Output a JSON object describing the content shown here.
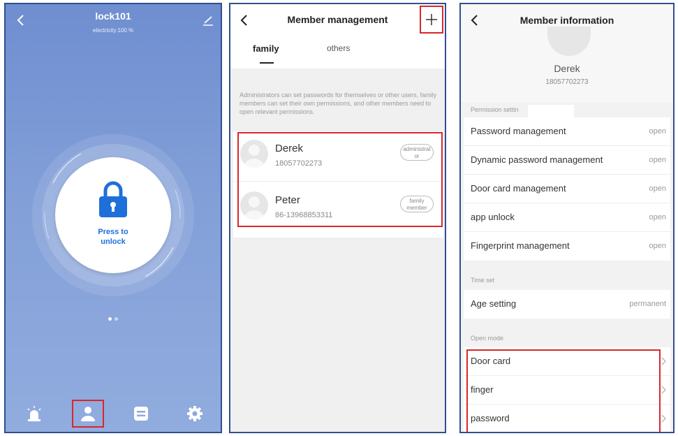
{
  "screen1": {
    "title": "lock101",
    "subtitle": "electricity:100 %",
    "unlock_line1": "Press to",
    "unlock_line2": "unlock",
    "page_indicator": {
      "total": 2,
      "active": 1
    },
    "nav_icons": [
      "alarm-icon",
      "user-icon",
      "records-icon",
      "settings-icon"
    ],
    "highlight_color": "#d9262c",
    "accent_color": "#1e6fd9"
  },
  "screen2": {
    "title": "Member management",
    "tabs": {
      "family": "family",
      "others": "others"
    },
    "notice": "Administrators can set passwords for themselves or other users, family members can set their own permissions, and other members need to open relevant permissions.",
    "members": [
      {
        "name": "Derek",
        "phone": "18057702273",
        "badge": "administrat or"
      },
      {
        "name": "Peter",
        "phone": "86-13968853311",
        "badge": "family member"
      }
    ]
  },
  "screen3": {
    "title": "Member information",
    "name": "Derek",
    "phone": "18057702273",
    "permission_label": "Permission settin",
    "permissions": [
      {
        "label": "Password management",
        "value": "open"
      },
      {
        "label": "Dynamic password management",
        "value": "open"
      },
      {
        "label": "Door card management",
        "value": "open"
      },
      {
        "label": "app unlock",
        "value": "open"
      },
      {
        "label": "Fingerprint management",
        "value": "open"
      }
    ],
    "time_label": "Time set",
    "time_row": {
      "label": "Age setting",
      "value": "permanent"
    },
    "open_mode_label": "Open mode",
    "open_modes": [
      "Door card",
      "finger",
      "password"
    ]
  }
}
